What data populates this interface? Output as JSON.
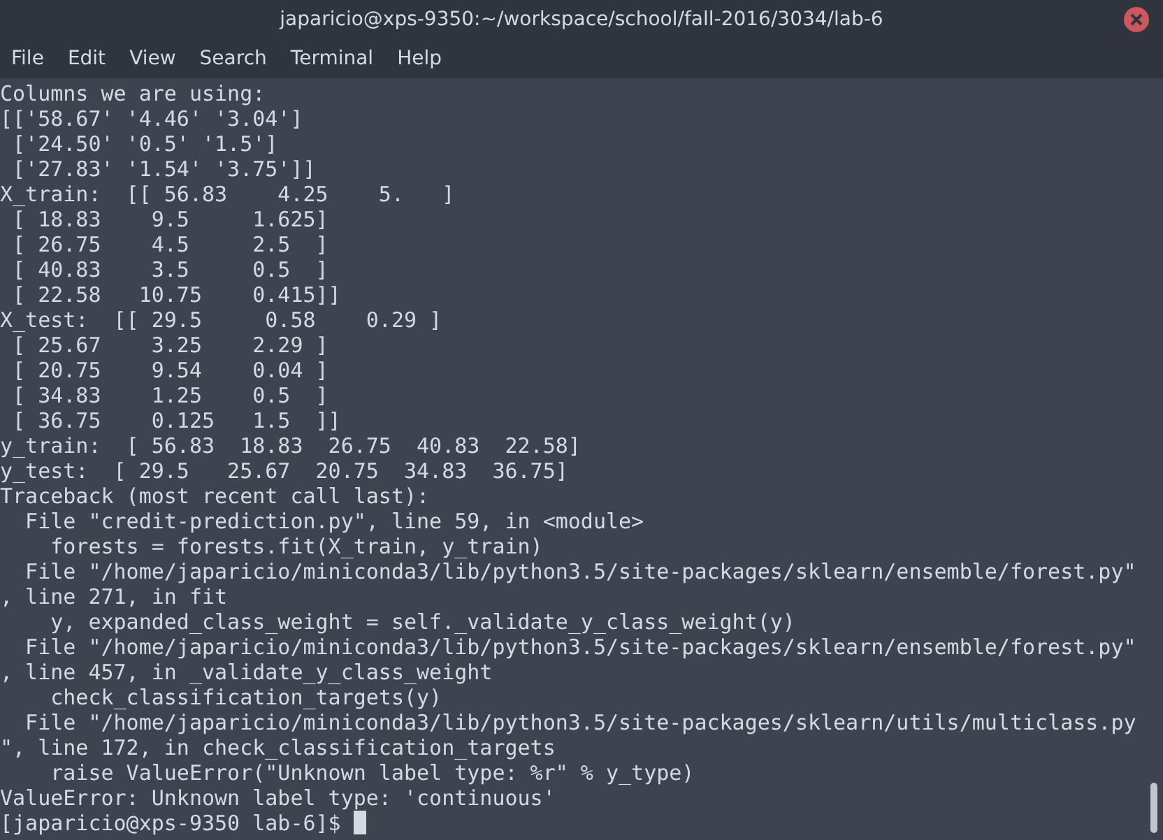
{
  "window": {
    "title": "japaricio@xps-9350:~/workspace/school/fall-2016/3034/lab-6"
  },
  "menu": [
    "File",
    "Edit",
    "View",
    "Search",
    "Terminal",
    "Help"
  ],
  "terminal": {
    "lines": [
      "Columns we are using:",
      "[['58.67' '4.46' '3.04']",
      " ['24.50' '0.5' '1.5']",
      " ['27.83' '1.54' '3.75']]",
      "X_train:  [[ 56.83    4.25    5.   ]",
      " [ 18.83    9.5     1.625]",
      " [ 26.75    4.5     2.5  ]",
      " [ 40.83    3.5     0.5  ]",
      " [ 22.58   10.75    0.415]]",
      "X_test:  [[ 29.5     0.58    0.29 ]",
      " [ 25.67    3.25    2.29 ]",
      " [ 20.75    9.54    0.04 ]",
      " [ 34.83    1.25    0.5  ]",
      " [ 36.75    0.125   1.5  ]]",
      "y_train:  [ 56.83  18.83  26.75  40.83  22.58]",
      "y_test:  [ 29.5   25.67  20.75  34.83  36.75]",
      "Traceback (most recent call last):",
      "  File \"credit-prediction.py\", line 59, in <module>",
      "    forests = forests.fit(X_train, y_train)",
      "  File \"/home/japaricio/miniconda3/lib/python3.5/site-packages/sklearn/ensemble/forest.py\"",
      ", line 271, in fit",
      "    y, expanded_class_weight = self._validate_y_class_weight(y)",
      "  File \"/home/japaricio/miniconda3/lib/python3.5/site-packages/sklearn/ensemble/forest.py\"",
      ", line 457, in _validate_y_class_weight",
      "    check_classification_targets(y)",
      "  File \"/home/japaricio/miniconda3/lib/python3.5/site-packages/sklearn/utils/multiclass.py",
      "\", line 172, in check_classification_targets",
      "    raise ValueError(\"Unknown label type: %r\" % y_type)",
      "ValueError: Unknown label type: 'continuous'"
    ],
    "prompt": "[japaricio@xps-9350 lab-6]$ "
  }
}
